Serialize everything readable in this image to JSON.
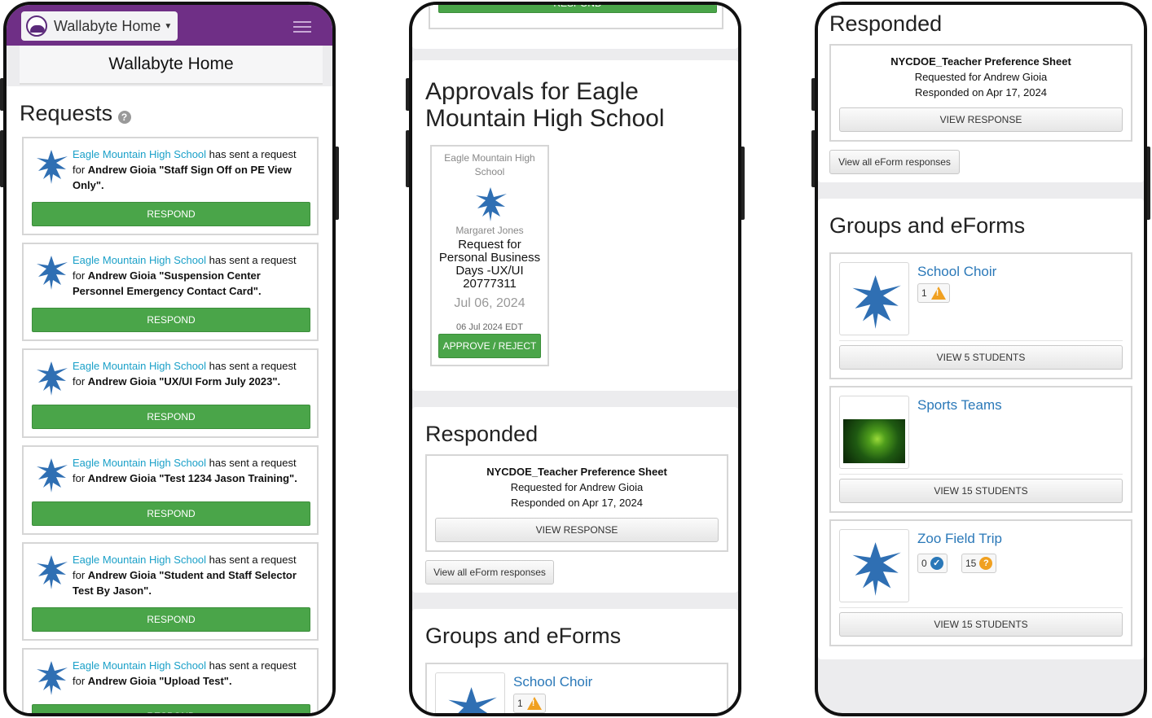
{
  "app": {
    "brand": "Wallabyte Home",
    "page_title": "Wallabyte Home"
  },
  "requests": {
    "title": "Requests",
    "help": "?",
    "respond_label": "RESPOND",
    "sender": "Eagle Mountain High School",
    "sent_text": " has sent a request",
    "for_text": "for ",
    "items": [
      {
        "person": "Andrew Gioia",
        "form": "\"Staff Sign Off on PE View Only\"."
      },
      {
        "person": "Andrew Gioia",
        "form": "\"Suspension Center Personnel Emergency Contact Card\"."
      },
      {
        "person": "Andrew Gioia",
        "form": "\"UX/UI Form July 2023\"."
      },
      {
        "person": "Andrew Gioia",
        "form": "\"Test 1234 Jason Training\"."
      },
      {
        "person": "Andrew Gioia",
        "form": "\"Student and Staff Selector Test By Jason\"."
      },
      {
        "person": "Andrew Gioia",
        "form": "\"Upload Test\"."
      }
    ]
  },
  "approvals": {
    "title": "Approvals for Eagle Mountain High School",
    "card": {
      "school": "Eagle Mountain High School",
      "requester": "Margaret Jones",
      "request": "Request for Personal Business Days -UX/UI 20777311",
      "date": "Jul 06, 2024",
      "timestamp": "06 Jul 2024 EDT",
      "button": "APPROVE / REJECT"
    },
    "top_respond": "RESPOND"
  },
  "responded": {
    "title": "Responded",
    "form": "NYCDOE_Teacher Preference Sheet",
    "requested_for": "Requested for Andrew Gioia",
    "responded_on": "Responded on Apr 17, 2024",
    "view_response": "VIEW RESPONSE",
    "view_all": "View all eForm responses"
  },
  "groups": {
    "title": "Groups and eForms",
    "items": [
      {
        "name": "School Choir",
        "badges": [
          {
            "count": "1",
            "icon": "warning-icon"
          }
        ],
        "button": "VIEW 5 STUDENTS"
      },
      {
        "name": "Sports Teams",
        "badges": [],
        "button": "VIEW 15 STUDENTS"
      },
      {
        "name": "Zoo Field Trip",
        "badges": [
          {
            "count": "0",
            "icon": "check-icon"
          },
          {
            "count": "15",
            "icon": "question-icon"
          }
        ],
        "button": "VIEW 15 STUDENTS"
      }
    ]
  },
  "colors": {
    "brand_purple": "#6f2f86",
    "respond_green": "#4aa549",
    "link_blue": "#1aa0c8",
    "group_blue": "#2a78b8",
    "warning_orange": "#f0a020",
    "check_blue": "#2a78b8"
  }
}
